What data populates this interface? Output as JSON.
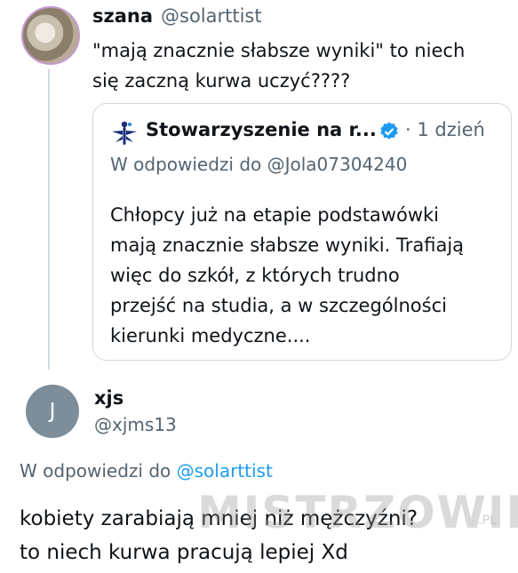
{
  "tweet1": {
    "name": "szana",
    "handle": "@solarttist",
    "text_line1": "\"mają znacznie słabsze wyniki\" to niech",
    "text_line2": "się zaczną kurwa uczyć????"
  },
  "quote": {
    "name": "Stowarzyszenie na r...",
    "separator": "·",
    "time": "1 dzień",
    "reply_to": "W odpowiedzi do @Jola07304240",
    "lines": [
      "Chłopcy już na etapie podstawówki",
      "mają znacznie słabsze wyniki. Trafiają",
      "więc do szkół, z których trudno",
      "przejść na studia, a w szczególności",
      "kierunki medyczne...."
    ],
    "verified_color": "#1d9bf0",
    "logo_color": "#1a2b7a"
  },
  "tweet2": {
    "avatar_letter": "J",
    "name": "xjs",
    "handle": "@xjms13",
    "reply_prefix": "W odpowiedzi do ",
    "reply_mention": "@solarttist",
    "text_line1": "kobiety zarabiają mniej niż mężczyźni?",
    "text_line2": "to niech kurwa pracują lepiej Xd"
  },
  "watermark": {
    "text": "MISTRZOWIE",
    "suffix": ".PL"
  }
}
